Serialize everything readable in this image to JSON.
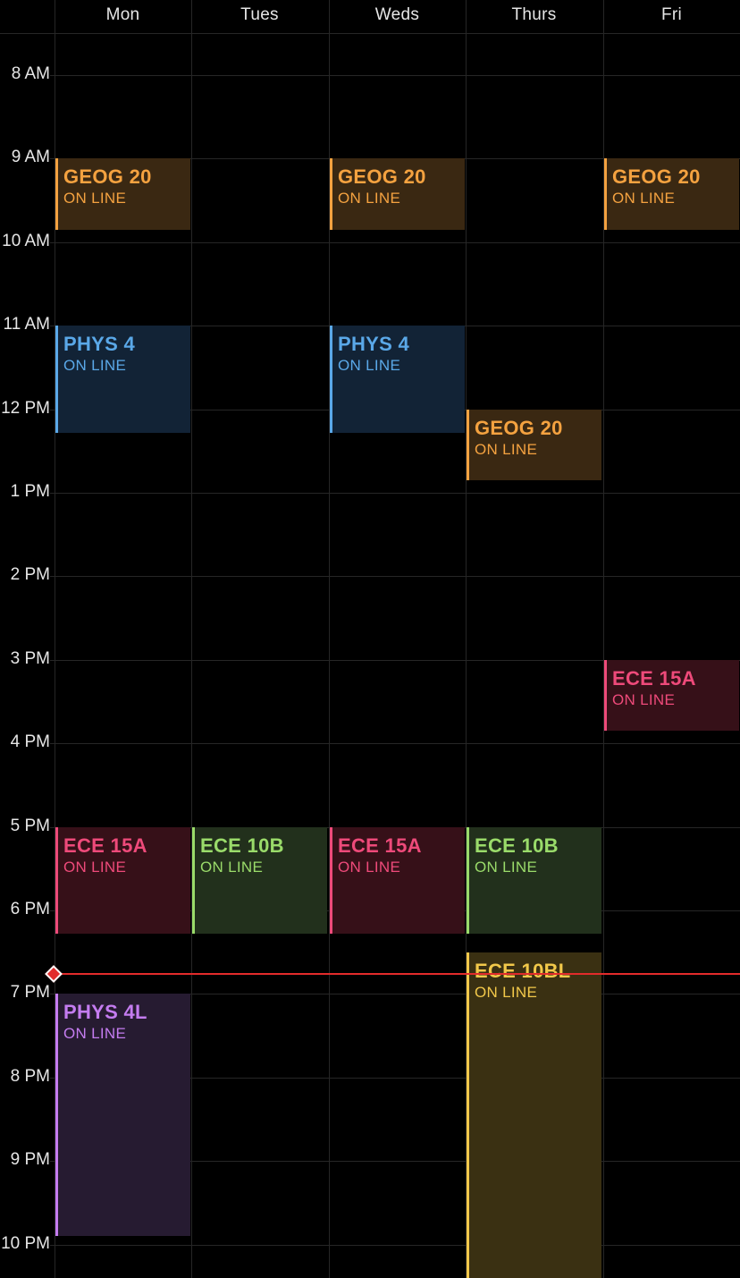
{
  "days": [
    "Mon",
    "Tues",
    "Weds",
    "Thurs",
    "Fri"
  ],
  "hours": [
    "8 AM",
    "9 AM",
    "10 AM",
    "11 AM",
    "12 PM",
    "1 PM",
    "2 PM",
    "3 PM",
    "4 PM",
    "5 PM",
    "6 PM",
    "7 PM",
    "8 PM",
    "9 PM",
    "10 PM"
  ],
  "colors": {
    "orange": {
      "accent": "#f4a240",
      "fill": "#3a2812"
    },
    "blue": {
      "accent": "#5aa8e8",
      "fill": "#122336"
    },
    "pink": {
      "accent": "#ee4a7a",
      "fill": "#361018"
    },
    "green": {
      "accent": "#9adb6a",
      "fill": "#22301c"
    },
    "purple": {
      "accent": "#c47cf0",
      "fill": "#261b31"
    },
    "yellow": {
      "accent": "#f2c84a",
      "fill": "#3a3012"
    },
    "now_indicator": "#e22b2b"
  },
  "events": [
    {
      "title": "GEOG 20",
      "location": "ON LINE",
      "day": 0,
      "start": 9,
      "end": 9.85,
      "color": "orange"
    },
    {
      "title": "GEOG 20",
      "location": "ON LINE",
      "day": 2,
      "start": 9,
      "end": 9.85,
      "color": "orange"
    },
    {
      "title": "GEOG 20",
      "location": "ON LINE",
      "day": 4,
      "start": 9,
      "end": 9.85,
      "color": "orange"
    },
    {
      "title": "PHYS 4",
      "location": "ON LINE",
      "day": 0,
      "start": 11,
      "end": 12.28,
      "color": "blue"
    },
    {
      "title": "PHYS 4",
      "location": "ON LINE",
      "day": 2,
      "start": 11,
      "end": 12.28,
      "color": "blue"
    },
    {
      "title": "GEOG 20",
      "location": "ON LINE",
      "day": 3,
      "start": 12,
      "end": 12.85,
      "color": "orange"
    },
    {
      "title": "ECE 15A",
      "location": "ON LINE",
      "day": 4,
      "start": 15,
      "end": 15.85,
      "color": "pink"
    },
    {
      "title": "ECE 15A",
      "location": "ON LINE",
      "day": 0,
      "start": 17,
      "end": 18.28,
      "color": "pink"
    },
    {
      "title": "ECE 10B",
      "location": "ON LINE",
      "day": 1,
      "start": 17,
      "end": 18.28,
      "color": "green"
    },
    {
      "title": "ECE 15A",
      "location": "ON LINE",
      "day": 2,
      "start": 17,
      "end": 18.28,
      "color": "pink"
    },
    {
      "title": "ECE 10B",
      "location": "ON LINE",
      "day": 3,
      "start": 17,
      "end": 18.28,
      "color": "green"
    },
    {
      "title": "ECE 10BL",
      "location": "ON LINE",
      "day": 3,
      "start": 18.5,
      "end": 22.4,
      "color": "yellow"
    },
    {
      "title": "PHYS 4L",
      "location": "ON LINE",
      "day": 0,
      "start": 19,
      "end": 21.9,
      "color": "purple"
    }
  ],
  "current_time": 18.75
}
